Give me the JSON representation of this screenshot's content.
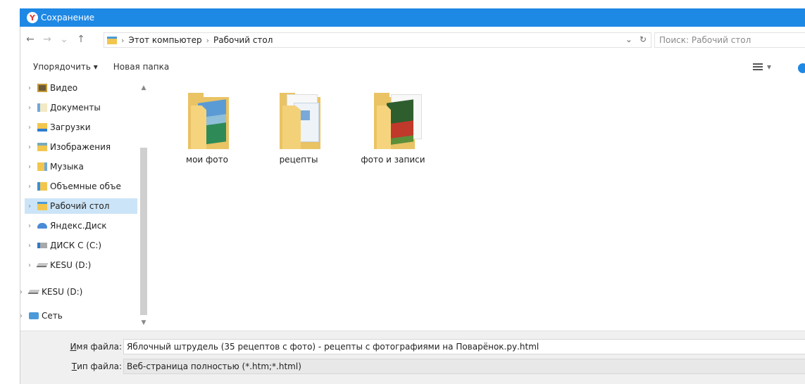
{
  "window": {
    "title": "Сохранение",
    "app_icon": "yandex-browser-icon"
  },
  "nav": {
    "back": "←",
    "forward": "→",
    "recent": "⌄",
    "up": "↑",
    "breadcrumb": [
      "Этот компьютер",
      "Рабочий стол"
    ],
    "separator": "›",
    "dropdown": "⌄",
    "refresh": "↻",
    "search_placeholder": "Поиск: Рабочий стол"
  },
  "toolbar": {
    "organize": "Упорядочить ▾",
    "new_folder": "Новая папка",
    "view_caret": "▾"
  },
  "sidebar": {
    "items": [
      {
        "label": "Видео",
        "icon": "video-folder-icon"
      },
      {
        "label": "Документы",
        "icon": "documents-folder-icon"
      },
      {
        "label": "Загрузки",
        "icon": "downloads-folder-icon"
      },
      {
        "label": "Изображения",
        "icon": "pictures-folder-icon"
      },
      {
        "label": "Музыка",
        "icon": "music-folder-icon"
      },
      {
        "label": "Объемные объе",
        "icon": "3d-objects-folder-icon"
      },
      {
        "label": "Рабочий стол",
        "icon": "desktop-folder-icon",
        "selected": true
      },
      {
        "label": "Яндекс.Диск",
        "icon": "yandex-disk-icon"
      },
      {
        "label": "ДИСК С (C:)",
        "icon": "drive-c-icon"
      },
      {
        "label": "KESU (D:)",
        "icon": "drive-d-icon"
      },
      {
        "label": "KESU (D:)",
        "icon": "drive-d-icon"
      },
      {
        "label": "Сеть",
        "icon": "network-icon"
      }
    ],
    "arrow": "›"
  },
  "files": [
    {
      "name": "мои фото",
      "icon": "folder-photos-icon"
    },
    {
      "name": "рецепты",
      "icon": "folder-documents-icon"
    },
    {
      "name": "фото и записи",
      "icon": "folder-flowers-icon"
    }
  ],
  "footer": {
    "filename_label_u": "И",
    "filename_label_rest": "мя файла:",
    "filename_value": "Яблочный штрудель (35 рецептов с фото) - рецепты с фотографиями на Поварёнок.ру.html",
    "filetype_label_u": "Т",
    "filetype_label_rest": "ип файла:",
    "filetype_value": "Веб-страница полностью (*.htm;*.html)"
  },
  "colors": {
    "titlebar": "#1e88e5",
    "selection": "#cce4f7",
    "folder": "#f6d47d"
  }
}
